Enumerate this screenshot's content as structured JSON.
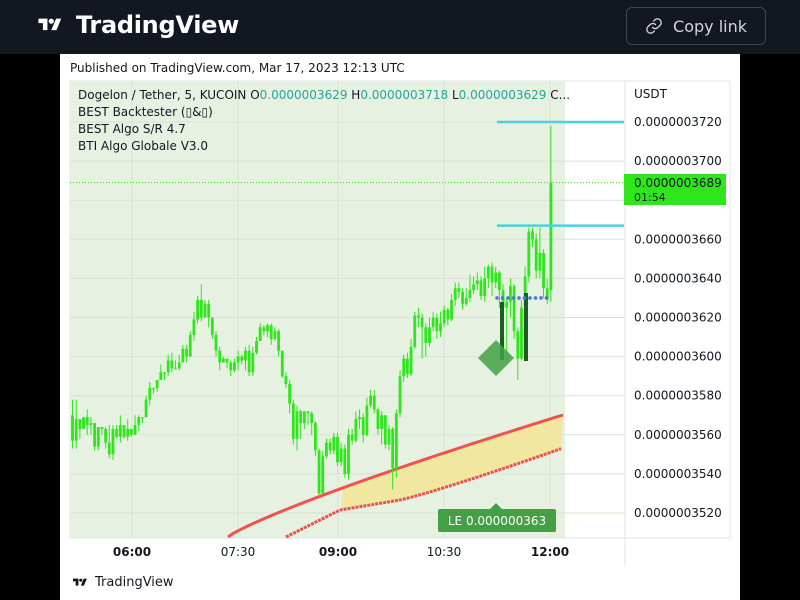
{
  "header": {
    "brand": "TradingView",
    "copy_link_label": "Copy link",
    "logo_icon": "tradingview-logo-icon",
    "link_icon": "link-icon"
  },
  "published_text": "Published on TradingView.com, Mar 17, 2023 12:13 UTC",
  "footer_brand": "TradingView",
  "chart_data": {
    "type": "candlestick",
    "symbol_line": {
      "symbol": "Dogelon / Tether, 5, KUCOIN",
      "o_label": "O",
      "o_value": "0.0000003629",
      "h_label": "H",
      "h_value": "0.0000003718",
      "l_label": "L",
      "l_value": "0.0000003629",
      "c_label": "C..."
    },
    "indicators": [
      "BEST Backtester (▯&▯)",
      "BEST Algo S/R 4.7",
      "BTI Algo Globale V3.0"
    ],
    "currency": "USDT",
    "y_ticks": [
      "0.0000003720",
      "0.0000003700",
      "0.0000003680",
      "0.0000003660",
      "0.0000003640",
      "0.0000003620",
      "0.0000003600",
      "0.0000003580",
      "0.0000003560",
      "0.0000003540",
      "0.0000003520"
    ],
    "y_tick_values": [
      372.0,
      370.0,
      368.0,
      366.0,
      364.0,
      362.0,
      360.0,
      358.0,
      356.0,
      354.0,
      352.0
    ],
    "x_ticks": [
      "06:00",
      "07:30",
      "09:00",
      "10:30",
      "12:00"
    ],
    "bold_x_ticks": [
      "06:00",
      "09:00",
      "12:00"
    ],
    "price_unit_note": "y values in units of 1e-9 USDT",
    "current_price": {
      "label": "0.0000003689",
      "value": 368.9,
      "countdown": "01:54"
    },
    "resistance_levels": [
      372.0,
      366.7
    ],
    "dotted_level": 363.0,
    "le_label": {
      "text": "LE 0.000000363",
      "value": 363.0
    },
    "candles": [
      [
        357.0,
        355.7,
        357.8,
        355.3
      ],
      [
        355.7,
        356.8,
        357.8,
        355.3
      ],
      [
        356.8,
        356.3,
        356.8,
        355.8
      ],
      [
        356.3,
        356.9,
        356.9,
        356.3
      ],
      [
        356.9,
        356.5,
        357.3,
        356.0
      ],
      [
        356.5,
        356.6,
        356.9,
        356.0
      ],
      [
        356.6,
        355.4,
        356.6,
        355.2
      ],
      [
        355.4,
        356.4,
        356.4,
        355.2
      ],
      [
        356.4,
        356.3,
        356.4,
        356.0
      ],
      [
        356.3,
        355.6,
        356.4,
        355.3
      ],
      [
        355.6,
        355.0,
        356.5,
        354.8
      ],
      [
        355.0,
        356.3,
        356.5,
        354.7
      ],
      [
        356.3,
        355.9,
        356.5,
        355.8
      ],
      [
        355.9,
        356.5,
        357.0,
        355.6
      ],
      [
        356.5,
        355.9,
        356.5,
        355.8
      ],
      [
        355.9,
        356.3,
        356.8,
        355.7
      ],
      [
        356.3,
        356.0,
        356.3,
        355.9
      ],
      [
        356.0,
        356.5,
        357.0,
        356.0
      ],
      [
        356.5,
        356.9,
        357.0,
        356.2
      ],
      [
        356.9,
        356.9,
        356.9,
        356.6
      ],
      [
        356.9,
        357.8,
        358.0,
        356.9
      ],
      [
        357.8,
        358.4,
        358.7,
        357.5
      ],
      [
        358.4,
        358.4,
        358.4,
        358.1
      ],
      [
        358.4,
        358.8,
        358.8,
        358.2
      ],
      [
        358.8,
        359.2,
        359.6,
        358.8
      ],
      [
        359.2,
        359.2,
        359.2,
        358.8
      ],
      [
        359.2,
        359.8,
        360.1,
        359.0
      ],
      [
        359.8,
        359.4,
        360.2,
        359.2
      ],
      [
        359.4,
        359.4,
        359.8,
        359.4
      ],
      [
        359.4,
        359.7,
        360.1,
        359.3
      ],
      [
        359.7,
        360.4,
        360.6,
        359.7
      ],
      [
        360.4,
        360.0,
        360.6,
        359.7
      ],
      [
        360.0,
        361.1,
        361.3,
        360.0
      ],
      [
        361.1,
        361.9,
        362.3,
        360.8
      ],
      [
        361.9,
        362.9,
        363.1,
        361.7
      ],
      [
        362.9,
        362.0,
        363.7,
        361.8
      ],
      [
        362.0,
        362.7,
        362.9,
        362.0
      ],
      [
        362.7,
        362.0,
        362.9,
        361.5
      ],
      [
        362.0,
        361.1,
        362.0,
        360.9
      ],
      [
        361.1,
        360.3,
        361.3,
        360.0
      ],
      [
        360.3,
        359.7,
        360.5,
        359.3
      ],
      [
        359.7,
        359.9,
        360.0,
        359.7
      ],
      [
        359.9,
        359.7,
        359.9,
        359.4
      ],
      [
        359.7,
        359.3,
        359.8,
        359.0
      ],
      [
        359.3,
        359.7,
        359.9,
        359.2
      ],
      [
        359.7,
        360.0,
        360.3,
        359.3
      ],
      [
        360.0,
        359.8,
        360.1,
        359.6
      ],
      [
        359.8,
        360.3,
        360.5,
        359.3
      ],
      [
        360.3,
        359.2,
        360.6,
        359.0
      ],
      [
        359.2,
        360.2,
        360.5,
        359.0
      ],
      [
        360.2,
        360.8,
        361.0,
        360.1
      ],
      [
        360.8,
        361.5,
        361.7,
        360.8
      ],
      [
        361.5,
        361.3,
        361.6,
        361.1
      ],
      [
        361.3,
        361.6,
        361.7,
        361.0
      ],
      [
        361.6,
        360.9,
        361.7,
        360.6
      ],
      [
        360.9,
        361.3,
        361.5,
        360.8
      ],
      [
        361.3,
        360.3,
        361.4,
        360.0
      ],
      [
        360.3,
        359.0,
        360.3,
        358.9
      ],
      [
        359.0,
        358.6,
        359.2,
        358.4
      ],
      [
        358.6,
        357.6,
        358.8,
        357.1
      ],
      [
        357.6,
        355.8,
        357.8,
        355.5
      ],
      [
        355.8,
        357.2,
        357.5,
        355.2
      ],
      [
        357.2,
        356.6,
        357.3,
        355.8
      ],
      [
        356.6,
        357.2,
        357.2,
        356.3
      ],
      [
        357.2,
        357.1,
        357.2,
        356.5
      ],
      [
        357.1,
        356.6,
        357.2,
        356.0
      ],
      [
        356.6,
        355.2,
        356.7,
        354.9
      ],
      [
        355.2,
        353.0,
        355.3,
        352.9
      ],
      [
        353.0,
        354.9,
        355.2,
        353.0
      ],
      [
        354.9,
        355.6,
        355.8,
        354.8
      ],
      [
        355.6,
        355.2,
        355.8,
        355.0
      ],
      [
        355.2,
        355.9,
        356.1,
        355.0
      ],
      [
        355.9,
        354.6,
        356.1,
        354.4
      ],
      [
        354.6,
        355.3,
        355.6,
        354.4
      ],
      [
        355.3,
        354.0,
        355.5,
        353.8
      ],
      [
        354.0,
        356.0,
        356.3,
        353.7
      ],
      [
        356.0,
        355.7,
        356.3,
        355.5
      ],
      [
        355.7,
        356.8,
        357.2,
        355.6
      ],
      [
        356.8,
        356.9,
        357.3,
        356.3
      ],
      [
        356.9,
        356.0,
        357.1,
        355.6
      ],
      [
        356.0,
        357.5,
        357.9,
        355.9
      ],
      [
        357.5,
        358.0,
        358.3,
        357.4
      ],
      [
        358.0,
        357.3,
        358.3,
        357.1
      ],
      [
        357.3,
        356.3,
        357.4,
        356.0
      ],
      [
        356.3,
        357.0,
        357.2,
        355.5
      ],
      [
        357.0,
        355.5,
        357.0,
        355.3
      ],
      [
        355.5,
        356.3,
        356.5,
        355.2
      ],
      [
        356.3,
        354.3,
        356.4,
        353.2
      ],
      [
        354.3,
        357.1,
        357.3,
        353.8
      ],
      [
        357.1,
        359.0,
        359.3,
        356.9
      ],
      [
        359.0,
        359.9,
        360.1,
        358.7
      ],
      [
        359.9,
        359.1,
        360.2,
        358.9
      ],
      [
        359.1,
        360.5,
        360.9,
        359.0
      ],
      [
        360.5,
        362.1,
        362.3,
        360.4
      ],
      [
        362.1,
        362.0,
        362.5,
        361.5
      ],
      [
        362.0,
        361.5,
        362.2,
        359.9
      ],
      [
        361.5,
        360.7,
        361.7,
        360.0
      ],
      [
        360.7,
        361.5,
        362.0,
        360.5
      ],
      [
        361.5,
        362.0,
        362.3,
        361.3
      ],
      [
        362.0,
        361.3,
        362.2,
        360.9
      ],
      [
        361.3,
        361.7,
        362.3,
        361.0
      ],
      [
        361.7,
        362.4,
        362.6,
        361.5
      ],
      [
        362.4,
        361.9,
        362.5,
        361.6
      ],
      [
        361.9,
        362.9,
        363.2,
        361.8
      ],
      [
        362.9,
        363.5,
        363.8,
        362.6
      ],
      [
        363.5,
        363.3,
        363.8,
        363.0
      ],
      [
        363.3,
        362.7,
        363.5,
        362.4
      ],
      [
        362.7,
        363.0,
        363.5,
        362.6
      ],
      [
        363.0,
        363.4,
        364.2,
        362.8
      ],
      [
        363.4,
        363.7,
        364.1,
        363.2
      ],
      [
        363.7,
        363.9,
        364.3,
        363.4
      ],
      [
        363.9,
        363.1,
        364.1,
        362.9
      ],
      [
        363.1,
        364.0,
        364.6,
        362.8
      ],
      [
        364.0,
        364.6,
        364.7,
        363.5
      ],
      [
        364.6,
        363.8,
        364.8,
        363.1
      ],
      [
        363.8,
        364.3,
        364.6,
        363.5
      ],
      [
        364.3,
        363.4,
        364.4,
        362.5
      ],
      [
        363.4,
        362.5,
        363.7,
        362.2
      ],
      [
        362.5,
        362.8,
        363.0,
        359.8
      ],
      [
        362.8,
        363.6,
        364.0,
        362.0
      ],
      [
        363.6,
        361.3,
        363.7,
        360.9
      ],
      [
        361.3,
        359.9,
        361.5,
        358.8
      ],
      [
        359.9,
        362.5,
        362.9,
        359.8
      ],
      [
        362.5,
        364.1,
        364.6,
        362.3
      ],
      [
        364.1,
        366.4,
        366.6,
        363.8
      ],
      [
        366.4,
        366.0,
        366.6,
        365.6
      ],
      [
        366.0,
        364.4,
        366.3,
        364.0
      ],
      [
        364.4,
        365.3,
        366.6,
        364.0
      ],
      [
        365.3,
        363.5,
        365.5,
        363.0
      ],
      [
        363.5,
        362.9,
        364.0,
        362.7
      ],
      [
        363.4,
        368.9,
        371.8,
        362.8
      ]
    ]
  }
}
